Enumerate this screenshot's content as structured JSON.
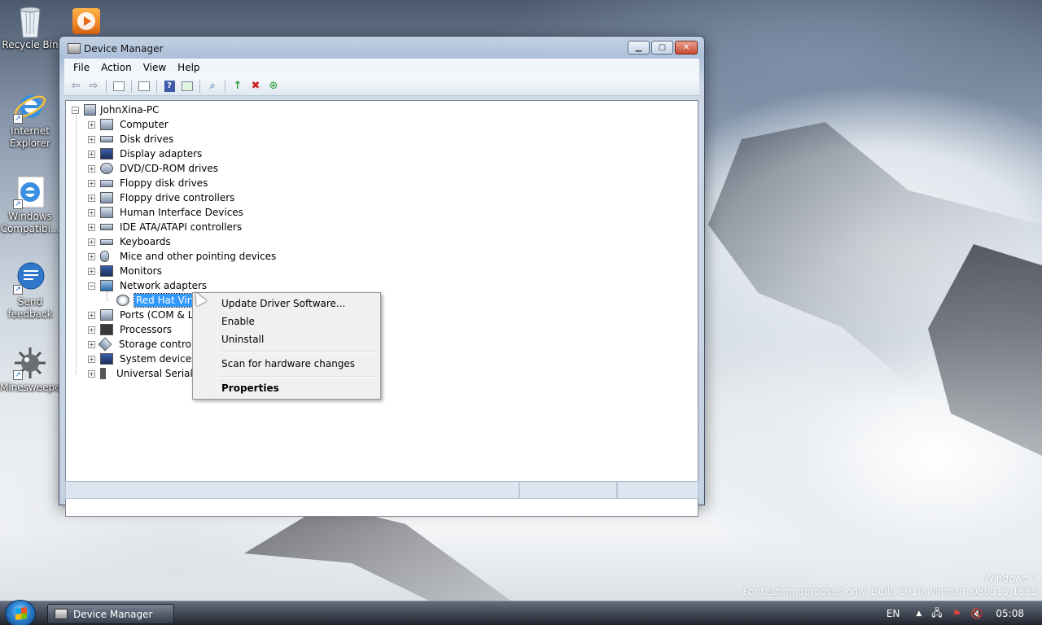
{
  "desktop": {
    "icons": [
      {
        "label": "Recycle Bin",
        "icon": "recycle-bin-icon"
      },
      {
        "label": "Internet Explorer",
        "icon": "internet-explorer-icon"
      },
      {
        "label": "Windows Compatibi...",
        "icon": "internet-explorer-icon"
      },
      {
        "label": "Send feedback",
        "icon": "send-feedback-icon"
      },
      {
        "label": "Minesweeper",
        "icon": "minesweeper-icon"
      }
    ],
    "watermark": {
      "line1": "Windows 7",
      "line2": "For testing purposes only. Build 6910.winmain.080915-1555"
    }
  },
  "window": {
    "title": "Device Manager",
    "title_icon": "device-manager-icon",
    "caption_buttons": {
      "minimize": "▁",
      "maximize": "▢",
      "close": "✕"
    },
    "menu": [
      "File",
      "Action",
      "View",
      "Help"
    ],
    "toolbar_icons": [
      "back-icon",
      "forward-icon",
      "show-hide-console-tree-icon",
      "properties-icon",
      "help-icon",
      "action-pane-icon",
      "scan-hardware-icon",
      "update-driver-icon",
      "uninstall-icon",
      "enable-device-icon"
    ],
    "toolbar_glyphs": {
      "back": "⇦",
      "forward": "⇨",
      "scan": "⌕",
      "update": "↑",
      "uninstall": "✖",
      "enable": "⊕",
      "help": "?"
    }
  },
  "tree": {
    "root": "JohnXina-PC",
    "expanded_glyph": "−",
    "collapsed_glyph": "+",
    "categories": [
      {
        "label": "Computer",
        "icon": "computer-icon"
      },
      {
        "label": "Disk drives",
        "icon": "disk-drive-icon"
      },
      {
        "label": "Display adapters",
        "icon": "display-adapter-icon"
      },
      {
        "label": "DVD/CD-ROM drives",
        "icon": "dvd-drive-icon"
      },
      {
        "label": "Floppy disk drives",
        "icon": "floppy-disk-icon"
      },
      {
        "label": "Floppy drive controllers",
        "icon": "floppy-controller-icon"
      },
      {
        "label": "Human Interface Devices",
        "icon": "hid-icon"
      },
      {
        "label": "IDE ATA/ATAPI controllers",
        "icon": "ide-controller-icon"
      },
      {
        "label": "Keyboards",
        "icon": "keyboard-icon"
      },
      {
        "label": "Mice and other pointing devices",
        "icon": "mouse-icon"
      },
      {
        "label": "Monitors",
        "icon": "monitor-icon"
      },
      {
        "label": "Network adapters",
        "icon": "network-adapter-icon",
        "expanded": true
      },
      {
        "label": "Red Hat VirtIO",
        "icon": "network-card-icon",
        "child": true,
        "selected": true
      },
      {
        "label": "Ports (COM & LPT",
        "icon": "port-icon"
      },
      {
        "label": "Processors",
        "icon": "processor-icon"
      },
      {
        "label": "Storage controller",
        "icon": "storage-controller-icon"
      },
      {
        "label": "System devices",
        "icon": "system-devices-icon"
      },
      {
        "label": "Universal Serial Bu",
        "icon": "usb-icon"
      }
    ]
  },
  "context_menu": {
    "items": [
      {
        "label": "Update Driver Software..."
      },
      {
        "label": "Enable"
      },
      {
        "label": "Uninstall"
      },
      {
        "label": "Scan for hardware changes"
      },
      {
        "label": "Properties",
        "bold": true
      }
    ]
  },
  "taskbar": {
    "task_button": "Device Manager",
    "language": "EN",
    "clock": "05:08",
    "tray_glyphs": {
      "show_hidden": "▲",
      "network": "🖧",
      "action_center": "⚑",
      "volume": "🔇"
    }
  },
  "colors": {
    "selection": "#3399ff",
    "window_frame": "#c3d2e2",
    "taskbar": "#1e2530"
  }
}
